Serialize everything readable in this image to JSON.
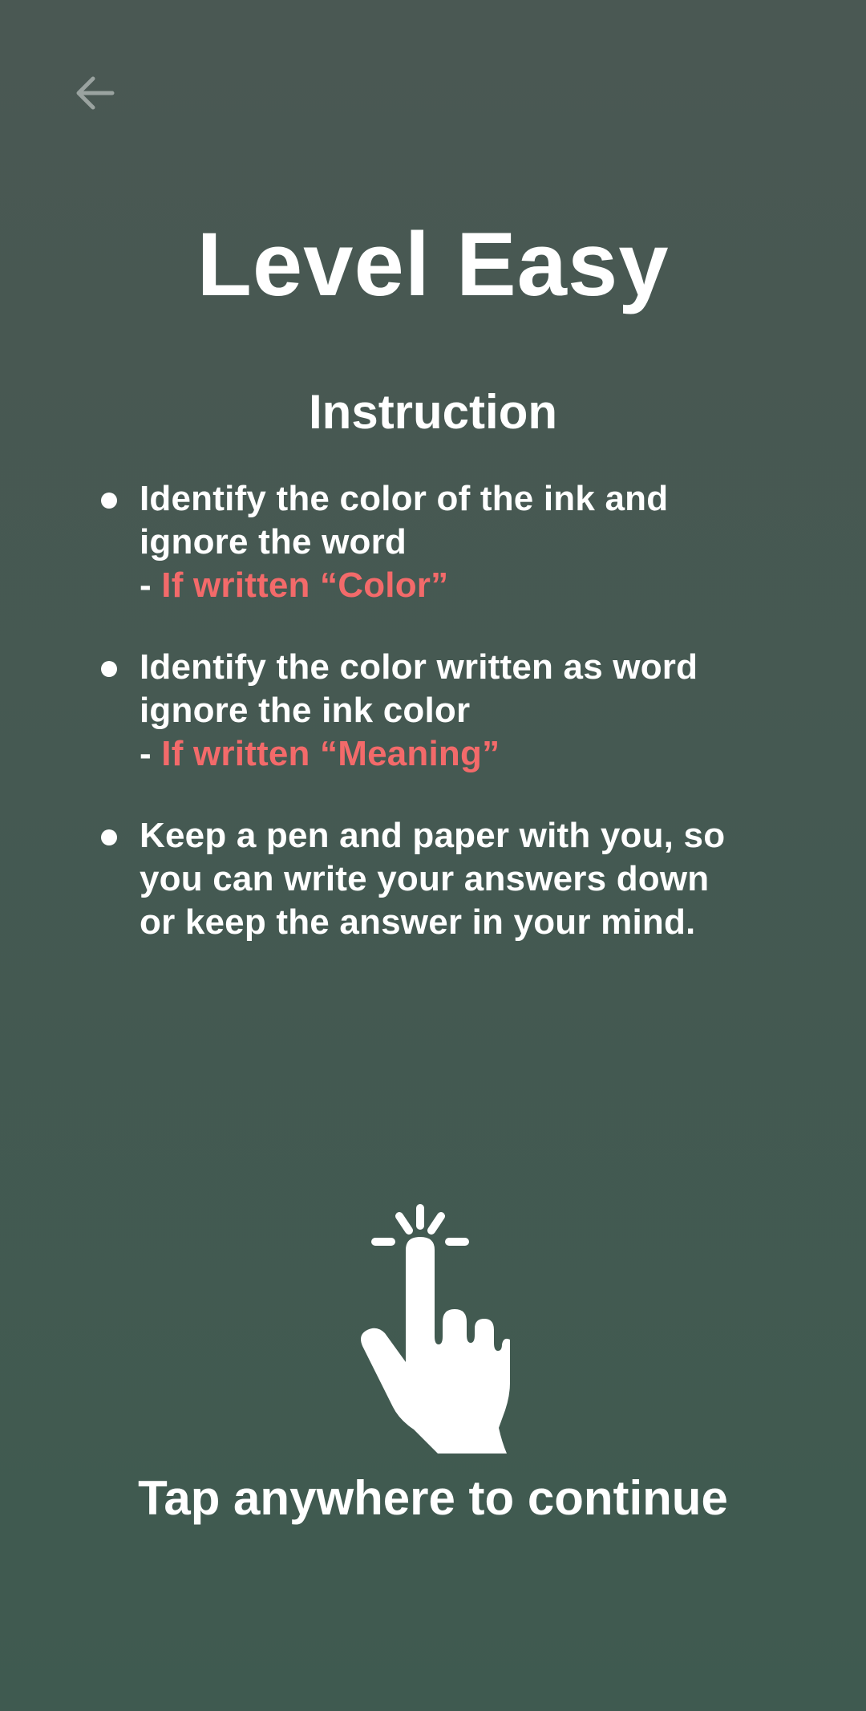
{
  "nav": {
    "back_icon": "arrow-left-icon",
    "back_icon_color": "#9aa3a0"
  },
  "title": "Level Easy",
  "instruction": {
    "heading": "Instruction",
    "items": [
      {
        "lines": [
          "Identify the color of the ink and",
          "ignore the word"
        ],
        "prefix": "- ",
        "highlight": "If written “Color”"
      },
      {
        "lines": [
          "Identify the color written as word",
          "ignore the ink color"
        ],
        "prefix": "- ",
        "highlight": "If written “Meaning”"
      },
      {
        "lines": [
          "Keep a pen and paper with you, so",
          "you can write your answers down",
          "or keep the answer in your mind."
        ]
      }
    ]
  },
  "tap": {
    "icon": "tap-hand-icon",
    "label": "Tap anywhere to continue"
  },
  "colors": {
    "background_top": "#4a5853",
    "background_bottom": "#3f5a50",
    "text": "#ffffff",
    "highlight": "#f36a6a"
  }
}
